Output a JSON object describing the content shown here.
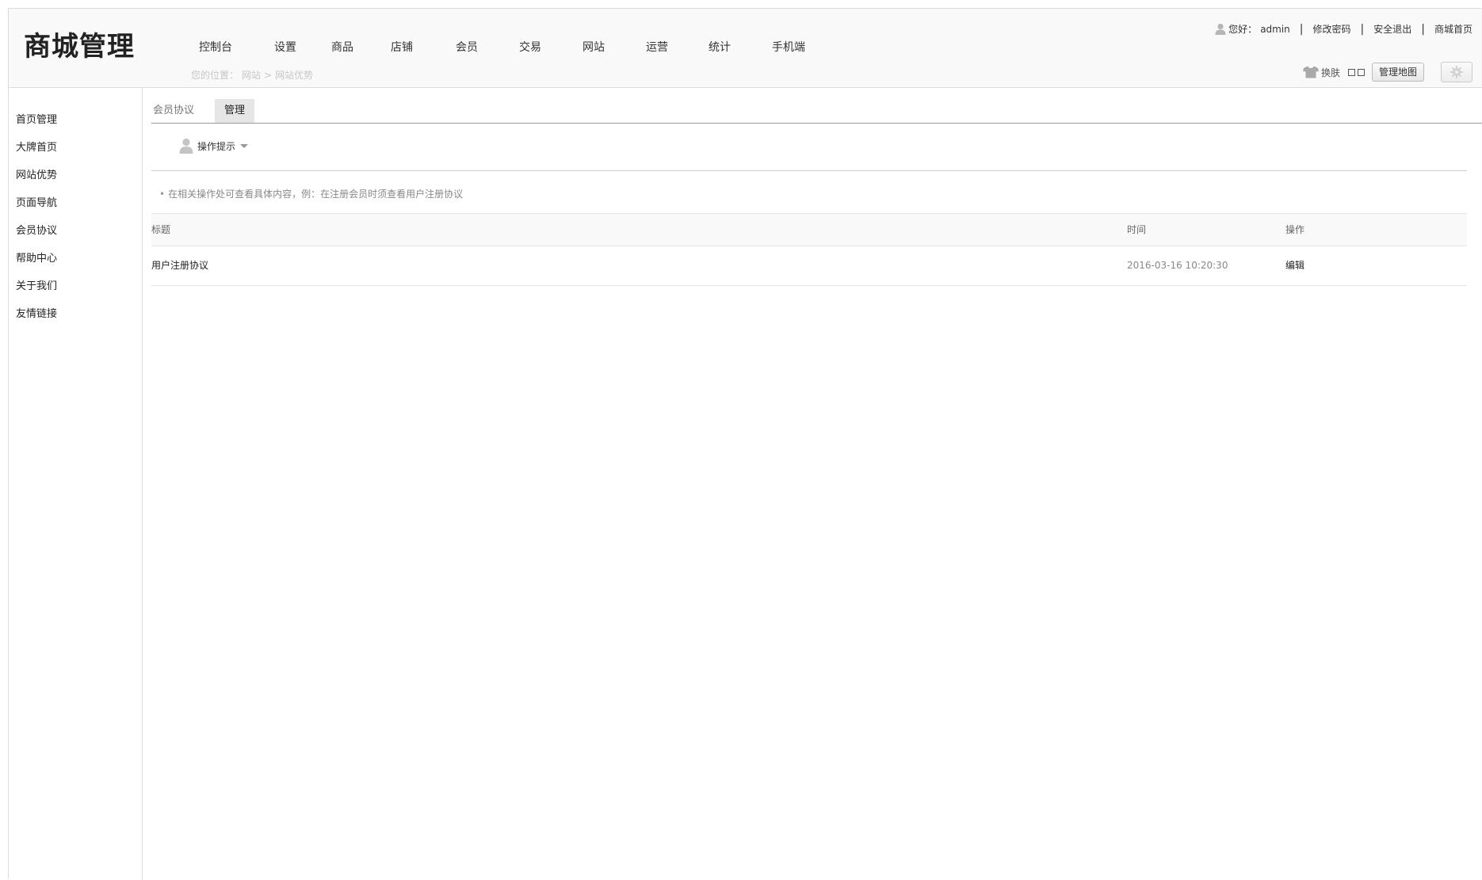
{
  "app": {
    "logo": "商城管理"
  },
  "topnav": {
    "items": [
      "控制台",
      "设置",
      "商品",
      "店铺",
      "会员",
      "交易",
      "网站",
      "运营",
      "统计",
      "手机端"
    ]
  },
  "breadcrumb": {
    "prefix": "您的位置：",
    "level1": "网站",
    "separator": ">",
    "level2": "网站优势"
  },
  "userbar": {
    "greeting": "您好：",
    "username": "admin",
    "change_password": "修改密码",
    "logout": "安全退出",
    "mall_home": "商城首页",
    "separator": "|"
  },
  "toolbar": {
    "skin_label": "换肤",
    "map_button": "管理地图"
  },
  "sidebar": {
    "items": [
      {
        "label": "首页管理"
      },
      {
        "label": "大牌首页"
      },
      {
        "label": "网站优势"
      },
      {
        "label": "页面导航"
      },
      {
        "label": "会员协议"
      },
      {
        "label": "帮助中心"
      },
      {
        "label": "关于我们"
      },
      {
        "label": "友情链接"
      }
    ]
  },
  "tabs": {
    "items": [
      {
        "label": "会员协议",
        "active": false
      },
      {
        "label": "管理",
        "active": true
      }
    ]
  },
  "tips": {
    "header": "操作提示",
    "bullet": "•",
    "text": "在相关操作处可查看具体内容，例：在注册会员时须查看用户注册协议"
  },
  "table": {
    "columns": [
      "标题",
      "时间",
      "操作"
    ],
    "rows": [
      {
        "title": "用户注册协议",
        "time": "2016-03-16  10:20:30",
        "action": "编辑"
      }
    ]
  },
  "colors": {
    "border": "#dcdcdc",
    "header_bg": "#f9f9f9",
    "active_tab_bg": "#e6e6e6",
    "muted_text": "#888888"
  }
}
